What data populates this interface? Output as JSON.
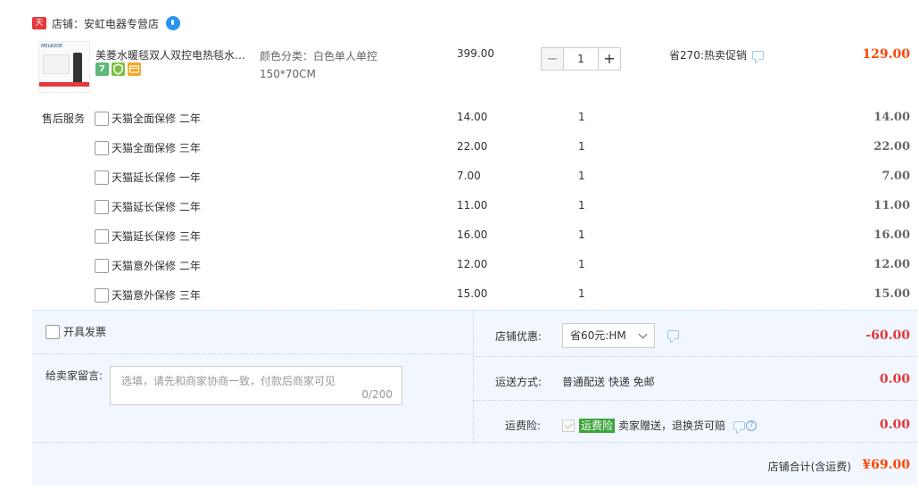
{
  "shop": {
    "badge": "天猫",
    "name": "店铺：安虹电器专营店"
  },
  "product": {
    "thumb_brand": "MELKODE",
    "title": "美菱水暖毯双人双控电热毯水循环...",
    "sku": "颜色分类：白色单人单控150*70CM",
    "price": "399.00",
    "quantity": "1",
    "qty_minus": "−",
    "qty_plus": "+",
    "promo": "省270:热卖促销",
    "subtotal": "129.00",
    "service_icons": [
      "7",
      "shield",
      "card"
    ]
  },
  "services": {
    "label": "售后服务",
    "items": [
      {
        "name": "天猫全面保修 二年",
        "price": "14.00",
        "qty": "1",
        "total": "14.00"
      },
      {
        "name": "天猫全面保修 三年",
        "price": "22.00",
        "qty": "1",
        "total": "22.00"
      },
      {
        "name": "天猫延长保修 一年",
        "price": "7.00",
        "qty": "1",
        "total": "7.00"
      },
      {
        "name": "天猫延长保修 二年",
        "price": "11.00",
        "qty": "1",
        "total": "11.00"
      },
      {
        "name": "天猫延长保修 三年",
        "price": "16.00",
        "qty": "1",
        "total": "16.00"
      },
      {
        "name": "天猫意外保修 二年",
        "price": "12.00",
        "qty": "1",
        "total": "12.00"
      },
      {
        "name": "天猫意外保修 三年",
        "price": "15.00",
        "qty": "1",
        "total": "15.00"
      }
    ]
  },
  "order": {
    "invoice_label": "开具发票",
    "note_label": "给卖家留言:",
    "note_placeholder": "选填，请先和商家协商一致，付款后商家可见",
    "note_count": "0/200",
    "discount_label": "店铺优惠:",
    "discount_selected": "省60元:HM",
    "discount_amount": "-60.00",
    "shipping_label": "运送方式:",
    "shipping_method": "普通配送 快递 免邮",
    "shipping_amount": "0.00",
    "insurance_label": "运费险:",
    "insurance_badge": "运费险",
    "insurance_text": "卖家赠送，退换货可赔",
    "insurance_amount": "0.00",
    "grand_label": "店铺合计(含运费)",
    "grand_total": "¥69.00"
  },
  "colors": {
    "price_red": "#ff4400",
    "accent_blue": "#2a94f0",
    "panel_bg": "#f2f7ff"
  }
}
